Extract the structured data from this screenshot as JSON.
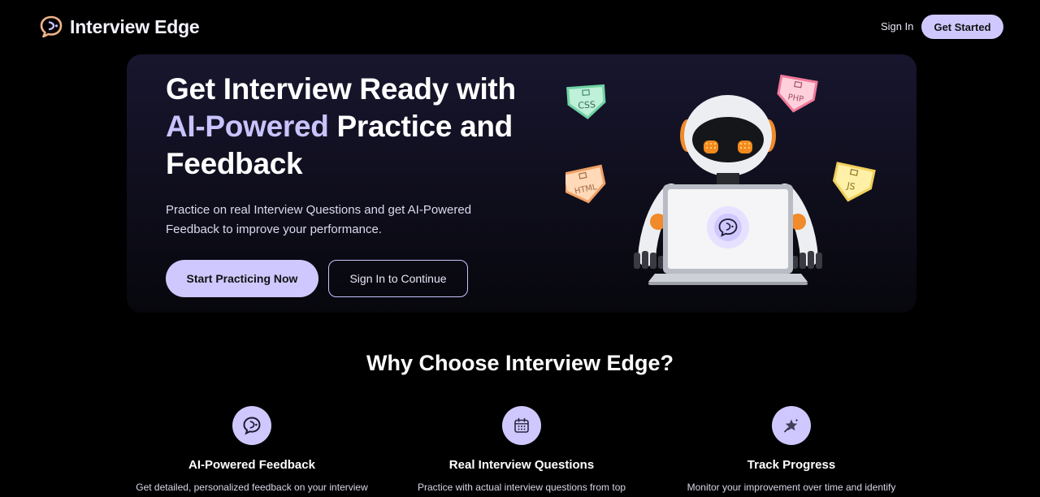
{
  "nav": {
    "brand": "Interview Edge",
    "sign_in": "Sign In",
    "get_started": "Get Started"
  },
  "hero": {
    "title_line1": "Get Interview Ready with",
    "title_accent": "AI-Powered",
    "title_line2_rest": " Practice and",
    "title_line3": "Feedback",
    "subtitle": "Practice on real Interview Questions and get AI-Powered Feedback to improve your performance.",
    "primary_cta": "Start Practicing Now",
    "secondary_cta": "Sign In to Continue",
    "badges": {
      "css": "CSS",
      "php": "PHP",
      "html": "HTML",
      "js": "JS"
    }
  },
  "why": {
    "title": "Why Choose Interview Edge?"
  },
  "features": [
    {
      "icon": "chat-bubble-icon",
      "title": "AI-Powered Feedback",
      "desc": "Get detailed, personalized feedback on your interview"
    },
    {
      "icon": "calendar-icon",
      "title": "Real Interview Questions",
      "desc": "Practice with actual interview questions from top"
    },
    {
      "icon": "star-sparkle-icon",
      "title": "Track Progress",
      "desc": "Monitor your improvement over time and identify"
    }
  ],
  "colors": {
    "accent": "#cfc8ff",
    "accent_text": "#c9c3ff",
    "background": "#000000",
    "hero_bg": "#18162e",
    "logo_orange": "#f2b48a"
  }
}
